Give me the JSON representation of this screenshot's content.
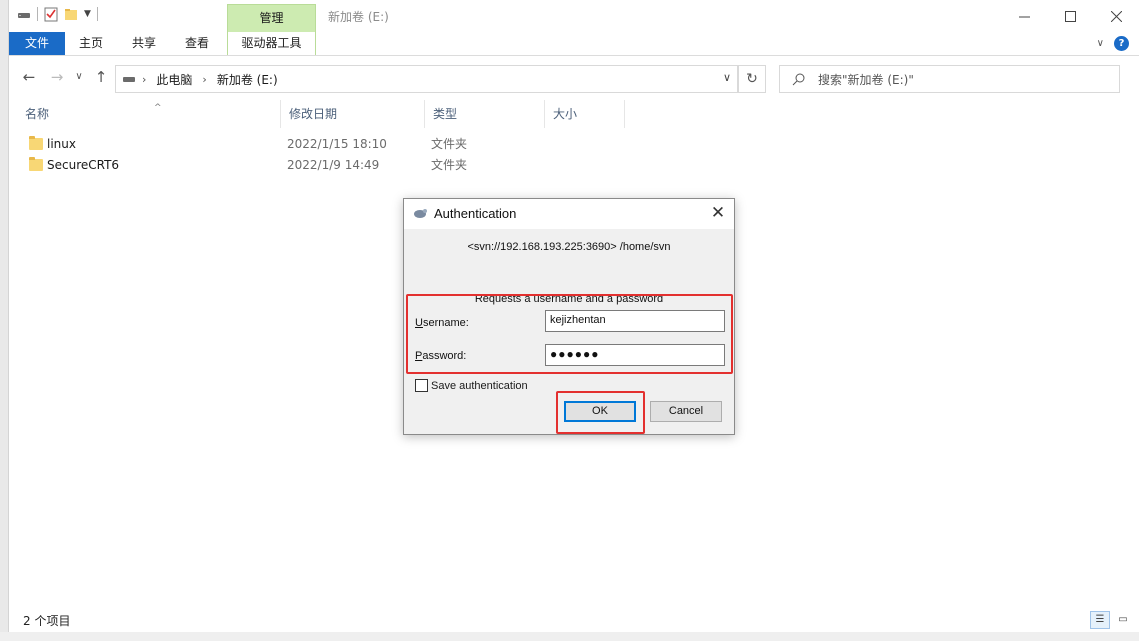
{
  "titlebar": {
    "context_tab": "管理",
    "window_title": "新加卷 (E:)",
    "controls": [
      "minimize",
      "maximize",
      "close"
    ]
  },
  "ribbon": {
    "file_tab": "文件",
    "tabs": [
      "主页",
      "共享",
      "查看"
    ],
    "context_subtab": "驱动器工具"
  },
  "address": {
    "crumbs": [
      "此电脑",
      "新加卷 (E:)"
    ]
  },
  "search": {
    "placeholder": "搜索\"新加卷 (E:)\""
  },
  "list": {
    "headers": {
      "name": "名称",
      "modified": "修改日期",
      "type": "类型",
      "size": "大小"
    },
    "items": [
      {
        "name": "linux",
        "modified": "2022/1/15 18:10",
        "type": "文件夹"
      },
      {
        "name": "SecureCRT6",
        "modified": "2022/1/9 14:49",
        "type": "文件夹"
      }
    ]
  },
  "status": {
    "count": "2 个项目"
  },
  "dialog": {
    "title": "Authentication",
    "realm": "<svn://192.168.193.225:3690> /home/svn",
    "subtitle": "Requests a username and a password",
    "username_label": "Username:",
    "username_value": "kejizhentan",
    "password_label": "Password:",
    "password_value": "●●●●●●",
    "save_label": "Save authentication",
    "save_checked": false,
    "ok_label": "OK",
    "cancel_label": "Cancel"
  },
  "colors": {
    "accent": "#1a6bc7",
    "context_tab": "#cdebb1",
    "highlight": "#e3302f"
  }
}
